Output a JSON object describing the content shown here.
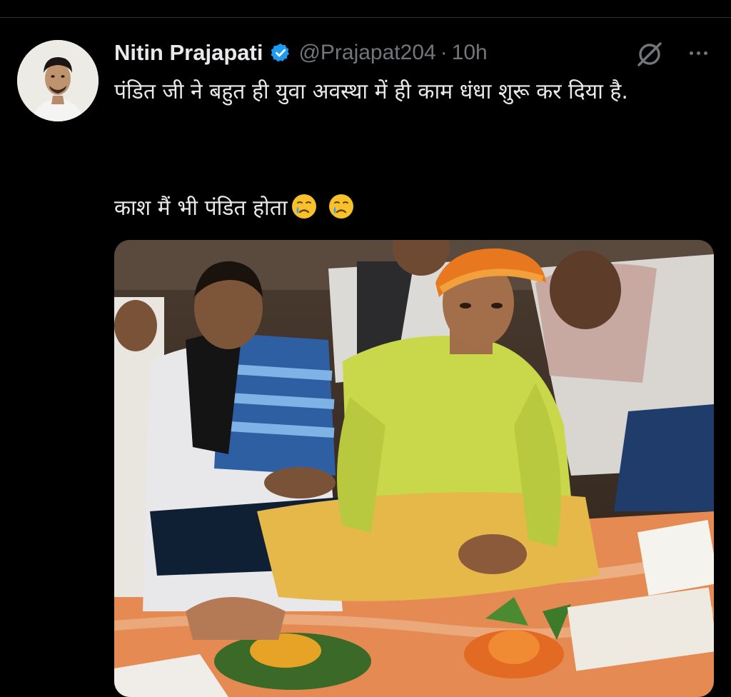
{
  "tweet": {
    "author_name": "Nitin Prajapati",
    "handle": "@Prajapat204",
    "separator": "·",
    "time": "10h",
    "text_line1": "पंडित जी ने बहुत ही युवा अवस्था में ही काम धंधा शुरू कर दिया है.",
    "text_line2": "काश मैं भी पंडित होता",
    "emojis": [
      "crying-face-emoji",
      "crying-face-emoji"
    ]
  },
  "icons": {
    "verified": "verified-badge-icon",
    "grok": "grok-icon",
    "more": "more-options-icon"
  },
  "colors": {
    "background": "#000000",
    "text_primary": "#e7e9ea",
    "text_secondary": "#71767b",
    "verified_blue": "#1d9bf0"
  }
}
